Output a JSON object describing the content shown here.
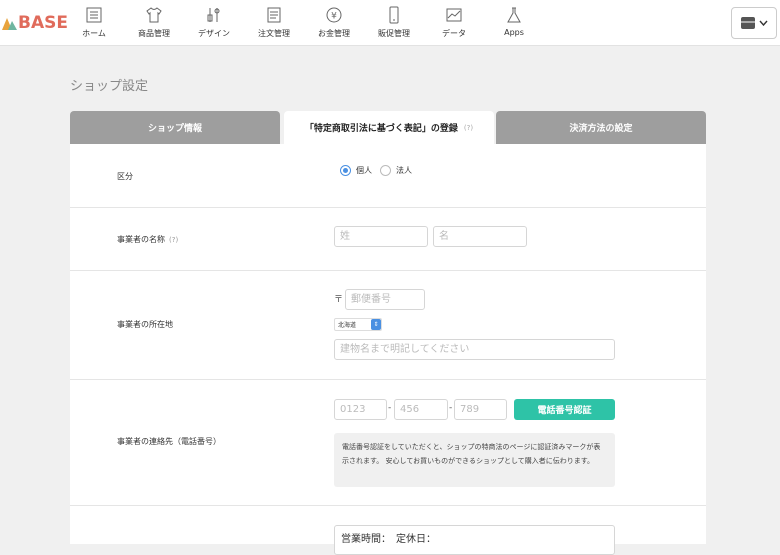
{
  "app": {
    "logo_text": "BASE"
  },
  "nav": [
    {
      "label": "ホーム",
      "icon": "home-icon"
    },
    {
      "label": "商品管理",
      "icon": "shirt-icon"
    },
    {
      "label": "デザイン",
      "icon": "brush-icon"
    },
    {
      "label": "注文管理",
      "icon": "document-icon"
    },
    {
      "label": "お金管理",
      "icon": "yen-icon"
    },
    {
      "label": "販促管理",
      "icon": "phone-icon"
    },
    {
      "label": "データ",
      "icon": "chart-icon"
    },
    {
      "label": "Apps",
      "icon": "flask-icon"
    }
  ],
  "page": {
    "title": "ショップ設定"
  },
  "tabs": [
    {
      "label": "ショップ情報",
      "active": false
    },
    {
      "label": "「特定商取引法に基づく表記」の登録",
      "help": "(?)",
      "active": true
    },
    {
      "label": "決済方法の設定",
      "active": false
    }
  ],
  "form": {
    "category": {
      "label": "区分",
      "options": [
        {
          "label": "個人",
          "selected": true
        },
        {
          "label": "法人",
          "selected": false
        }
      ]
    },
    "name": {
      "label": "事業者の名称",
      "help": "(?)",
      "last_placeholder": "姓",
      "first_placeholder": "名"
    },
    "address": {
      "label": "事業者の所在地",
      "postal_mark": "〒",
      "postal_placeholder": "郵便番号",
      "prefecture": "北海道",
      "building_placeholder": "建物名まで明記してください"
    },
    "phone": {
      "label": "事業者の連絡先（電話番号）",
      "part1_placeholder": "0123",
      "part2_placeholder": "456",
      "part3_placeholder": "789",
      "separator": "-",
      "verify_button": "電話番号認証",
      "notice": "電話番号認証をしていただくと、ショップの特商法のページに認証済みマークが表示されます。 安心してお買いものができるショップとして購入者に伝わります。"
    },
    "hours": {
      "value": "営業時間：　定休日："
    }
  },
  "colors": {
    "accent": "#2ec3a7",
    "tab_inactive": "#9e9e9e",
    "radio": "#4a90e2",
    "logo": "#e06b5b"
  }
}
